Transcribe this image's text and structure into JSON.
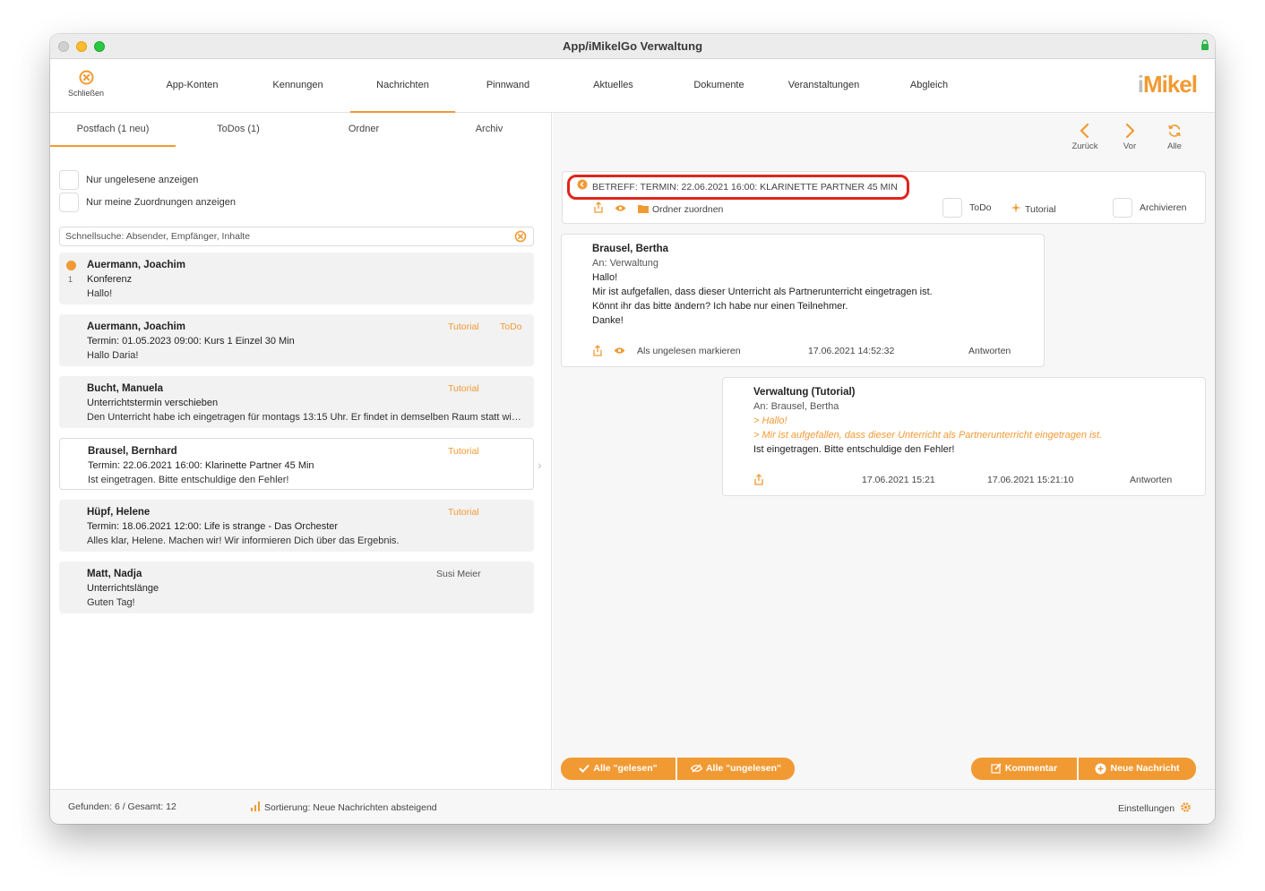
{
  "window": {
    "title": "App/iMikelGo Verwaltung"
  },
  "topnav": {
    "close_label": "Schließen",
    "tabs": [
      {
        "label": "App-Konten"
      },
      {
        "label": "Kennungen"
      },
      {
        "label": "Nachrichten"
      },
      {
        "label": "Pinnwand"
      },
      {
        "label": "Aktuelles"
      },
      {
        "label": "Dokumente"
      },
      {
        "label": "Veranstaltungen"
      },
      {
        "label": "Abgleich"
      }
    ],
    "active_tab": "Nachrichten",
    "logo_i": "i",
    "logo_rest": "Mikel"
  },
  "left": {
    "subtabs": [
      {
        "label": "Postfach (1 neu)"
      },
      {
        "label": "ToDos (1)"
      },
      {
        "label": "Ordner"
      },
      {
        "label": "Archiv"
      }
    ],
    "filter_unread": "Nur ungelesene anzeigen",
    "filter_mine": "Nur meine Zuordnungen anzeigen",
    "search_placeholder": "Schnellsuche: Absender, Empfänger, Inhalte",
    "messages": [
      {
        "sender": "Auermann, Joachim",
        "subject": "Konferenz",
        "preview": "Hallo!",
        "unread_count": "1",
        "tags": []
      },
      {
        "sender": "Auermann, Joachim",
        "subject": "Termin: 01.05.2023 09:00: Kurs 1 Einzel 30 Min",
        "preview": "Hallo Daria!",
        "tags": [
          "Tutorial",
          "ToDo"
        ]
      },
      {
        "sender": "Bucht, Manuela",
        "subject": "Unterrichtstermin verschieben",
        "preview": "Den Unterricht habe ich eingetragen für montags 13:15 Uhr. Er findet in demselben Raum statt wie bisher.",
        "tags": [
          "Tutorial"
        ]
      },
      {
        "sender": "Brausel, Bernhard",
        "subject": "Termin: 22.06.2021 16:00: Klarinette Partner 45 Min",
        "preview": "Ist eingetragen. Bitte entschuldige den Fehler!",
        "tags": [
          "Tutorial"
        ]
      },
      {
        "sender": "Hüpf, Helene",
        "subject": "Termin: 18.06.2021 12:00: Life is strange - Das Orchester",
        "preview": "Alles klar, Helene. Machen wir! Wir informieren Dich über das Ergebnis.",
        "tags": [
          "Tutorial"
        ]
      },
      {
        "sender": "Matt, Nadja",
        "subject": "Unterrichtslänge",
        "preview": "Guten Tag!",
        "tags": [
          "Susi Meier"
        ]
      }
    ]
  },
  "right": {
    "nav": {
      "back": "Zurück",
      "forward": "Vor",
      "all": "Alle"
    },
    "subject": "BETREFF: TERMIN: 22.06.2021 16:00: KLARINETTE PARTNER 45 MIN",
    "folder_label": "Ordner zuordnen",
    "todo_label": "ToDo",
    "tutorial_label": "Tutorial",
    "archive_label": "Archivieren",
    "thread": [
      {
        "from": "Brausel, Bertha",
        "to": "An: Verwaltung",
        "lines": [
          "Hallo!",
          "Mir ist aufgefallen, dass dieser Unterricht als Partnerunterricht eingetragen ist.",
          "Könnt ihr das bitte ändern? Ich habe nur einen Teilnehmer.",
          "Danke!"
        ],
        "mark_unread": "Als ungelesen markieren",
        "timestamp": "17.06.2021 14:52:32",
        "reply": "Antworten"
      },
      {
        "from": "Verwaltung (Tutorial)",
        "to": "An: Brausel, Bertha",
        "quotes": [
          "> Hallo!",
          "> Mir ist aufgefallen, dass dieser Unterricht als Partnerunterricht eingetragen ist."
        ],
        "lines": [
          "Ist eingetragen. Bitte entschuldige den Fehler!"
        ],
        "timestamp_1": "17.06.2021 15:21",
        "timestamp_2": "17.06.2021 15:21:10",
        "reply": "Antworten"
      }
    ],
    "buttons": {
      "all_read": "Alle \"gelesen\"",
      "all_unread": "Alle \"ungelesen\"",
      "comment": "Kommentar",
      "new_message": "Neue Nachricht"
    }
  },
  "status": {
    "found": "Gefunden: 6 / Gesamt: 12",
    "sort": "Sortierung: Neue Nachrichten absteigend",
    "settings": "Einstellungen"
  },
  "colors": {
    "accent": "#f19a33",
    "highlight": "#e0251b"
  },
  "icons": [
    "close-circle-icon",
    "lock-icon",
    "chevron-left-icon",
    "chevron-right-icon",
    "refresh-icon",
    "back-arrow-icon",
    "share-icon",
    "eye-icon",
    "folder-icon",
    "tutorial-icon",
    "checkmark-icon",
    "eye-slash-icon",
    "edit-icon",
    "plus-circle-icon",
    "bar-chart-icon",
    "gear-icon",
    "clear-search-icon"
  ]
}
